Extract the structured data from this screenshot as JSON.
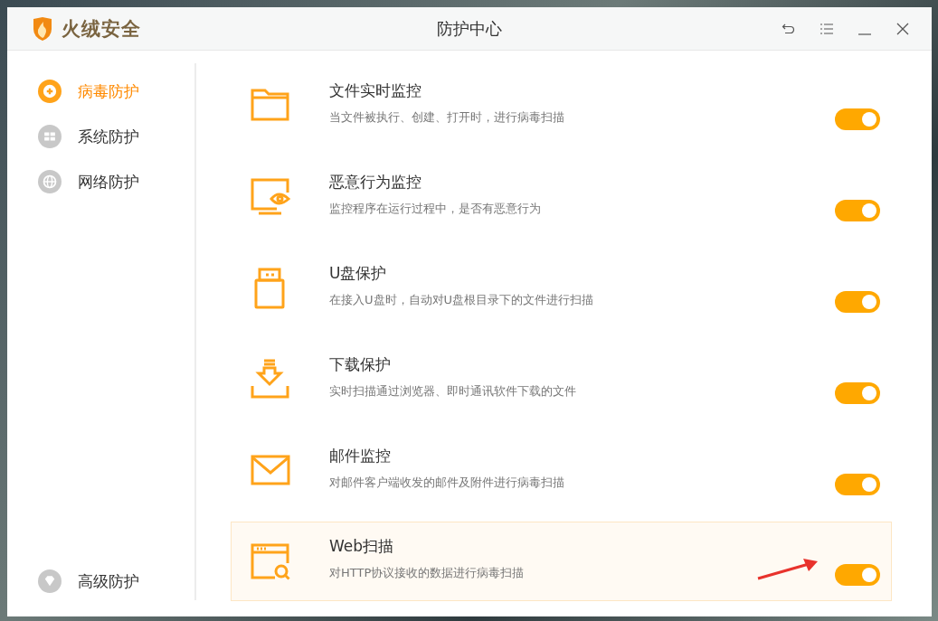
{
  "window": {
    "app_name": "火绒安全",
    "title": "防护中心"
  },
  "sidebar": {
    "items": [
      {
        "label": "病毒防护",
        "kind": "virus",
        "selected": true
      },
      {
        "label": "系统防护",
        "kind": "system",
        "selected": false
      },
      {
        "label": "网络防护",
        "kind": "network",
        "selected": false
      }
    ],
    "bottom_item": {
      "label": "高级防护",
      "kind": "advanced",
      "selected": false
    }
  },
  "features": [
    {
      "kind": "folder",
      "title": "文件实时监控",
      "description": "当文件被执行、创建、打开时，进行病毒扫描",
      "on": true,
      "highlighted": false
    },
    {
      "kind": "monitor",
      "title": "恶意行为监控",
      "description": "监控程序在运行过程中，是否有恶意行为",
      "on": true,
      "highlighted": false
    },
    {
      "kind": "usb",
      "title": "U盘保护",
      "description": "在接入U盘时，自动对U盘根目录下的文件进行扫描",
      "on": true,
      "highlighted": false
    },
    {
      "kind": "download",
      "title": "下载保护",
      "description": "实时扫描通过浏览器、即时通讯软件下载的文件",
      "on": true,
      "highlighted": false
    },
    {
      "kind": "mail",
      "title": "邮件监控",
      "description": "对邮件客户端收发的邮件及附件进行病毒扫描",
      "on": true,
      "highlighted": false
    },
    {
      "kind": "web",
      "title": "Web扫描",
      "description": "对HTTP协议接收的数据进行病毒扫描",
      "on": true,
      "highlighted": true
    }
  ]
}
